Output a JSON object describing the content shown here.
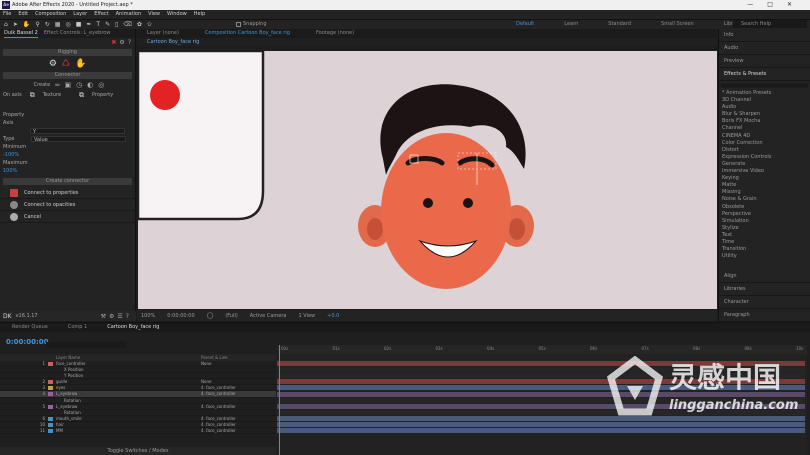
{
  "window": {
    "title": "Adobe After Effects 2020 - Untitled Project.aep *"
  },
  "menu": [
    "File",
    "Edit",
    "Composition",
    "Layer",
    "Effect",
    "Animation",
    "View",
    "Window",
    "Help"
  ],
  "toolbar": {
    "snapping": "Snapping"
  },
  "workspaces": [
    "Default",
    "Learn",
    "Standard",
    "Small Screen",
    "Libraries"
  ],
  "help_search": "Search Help",
  "left_panel": {
    "tabs": [
      "Duik Bassel 2",
      "Effect Controls: L_eyebrow"
    ],
    "rigging_header": "Rigging",
    "connector_header": "Connector",
    "create_label": "Create",
    "on_axis_label": "On axis",
    "texture_label": "Texture",
    "property_label": "Property",
    "property_text": "Property",
    "axis_label": "Axis",
    "axis_value": "Y",
    "type_label": "Type",
    "type_value": "Value",
    "min_label": "Minimum",
    "min_value": "-100%",
    "max_label": "Maximum",
    "max_value": "100%",
    "create_connector": "Create connector",
    "connect_properties": "Connect to properties",
    "connect_opacities": "Connect to opacities",
    "cancel": "Cancel",
    "version": "v16.1.17"
  },
  "viewer": {
    "tabs": [
      "Layer (none)",
      "Composition Cartoon Boy_face rig",
      "Footage (none)"
    ],
    "comp_tab": "Cartoon Boy_face rig",
    "zoom": "100%",
    "timecode": "0:00:00:00",
    "resolution": "(Full)",
    "camera": "Active Camera",
    "views": "1 View",
    "exposure": "+0.0"
  },
  "right_panel": {
    "headers": [
      "Info",
      "Audio",
      "Preview"
    ],
    "effects_header": "Effects & Presets",
    "effects": [
      "* Animation Presets",
      "3D Channel",
      "Audio",
      "Blur & Sharpen",
      "Boris FX Mocha",
      "Channel",
      "CINEMA 4D",
      "Color Correction",
      "Distort",
      "Expression Controls",
      "Generate",
      "Immersive Video",
      "Keying",
      "Matte",
      "Missing",
      "Noise & Grain",
      "Obsolete",
      "Perspective",
      "Simulation",
      "Stylize",
      "Text",
      "Time",
      "Transition",
      "Utility"
    ],
    "bottom_headers": [
      "Align",
      "Libraries",
      "Character",
      "Paragraph"
    ]
  },
  "timeline": {
    "tabs": [
      "Render Queue",
      "Comp 1",
      "Cartoon Boy_face rig"
    ],
    "timecode": "0:00:00:00",
    "columns": [
      "Layer Name",
      "Parent & Link"
    ],
    "layers": [
      {
        "num": "1",
        "name": "face_controller",
        "parent": "None",
        "color": "#d06060"
      },
      {
        "num": "",
        "name": "X Position",
        "parent": "",
        "color": ""
      },
      {
        "num": "",
        "name": "Y Position",
        "parent": "",
        "color": ""
      },
      {
        "num": "2",
        "name": "guide",
        "parent": "None",
        "color": "#d06060"
      },
      {
        "num": "3",
        "name": "eyes",
        "parent": "4. face_controller",
        "color": "#c0a050"
      },
      {
        "num": "4",
        "name": "L_eyebrow",
        "parent": "4. face_controller",
        "color": "#a060a0"
      },
      {
        "num": "",
        "name": "Rotation",
        "parent": "",
        "color": ""
      },
      {
        "num": "5",
        "name": "L_eyebrow",
        "parent": "4. face_controller",
        "color": "#a060a0"
      },
      {
        "num": "",
        "name": "Rotation",
        "parent": "",
        "color": ""
      },
      {
        "num": "6",
        "name": "mouth_smile",
        "parent": "4. face_controller",
        "color": "#4a90c0"
      },
      {
        "num": "10",
        "name": "hair",
        "parent": "4. face_controller",
        "color": "#4a90c0"
      },
      {
        "num": "11",
        "name": "MM",
        "parent": "4. face_controller",
        "color": "#4a90c0"
      }
    ],
    "ruler": [
      "00s",
      "01s",
      "02s",
      "03s",
      "04s",
      "05s",
      "06s",
      "07s",
      "08s",
      "09s",
      "10s"
    ],
    "footer": "Toggle Switches / Modes"
  },
  "watermark": {
    "brand": "灵感中国",
    "site": "lingganchina.com"
  }
}
